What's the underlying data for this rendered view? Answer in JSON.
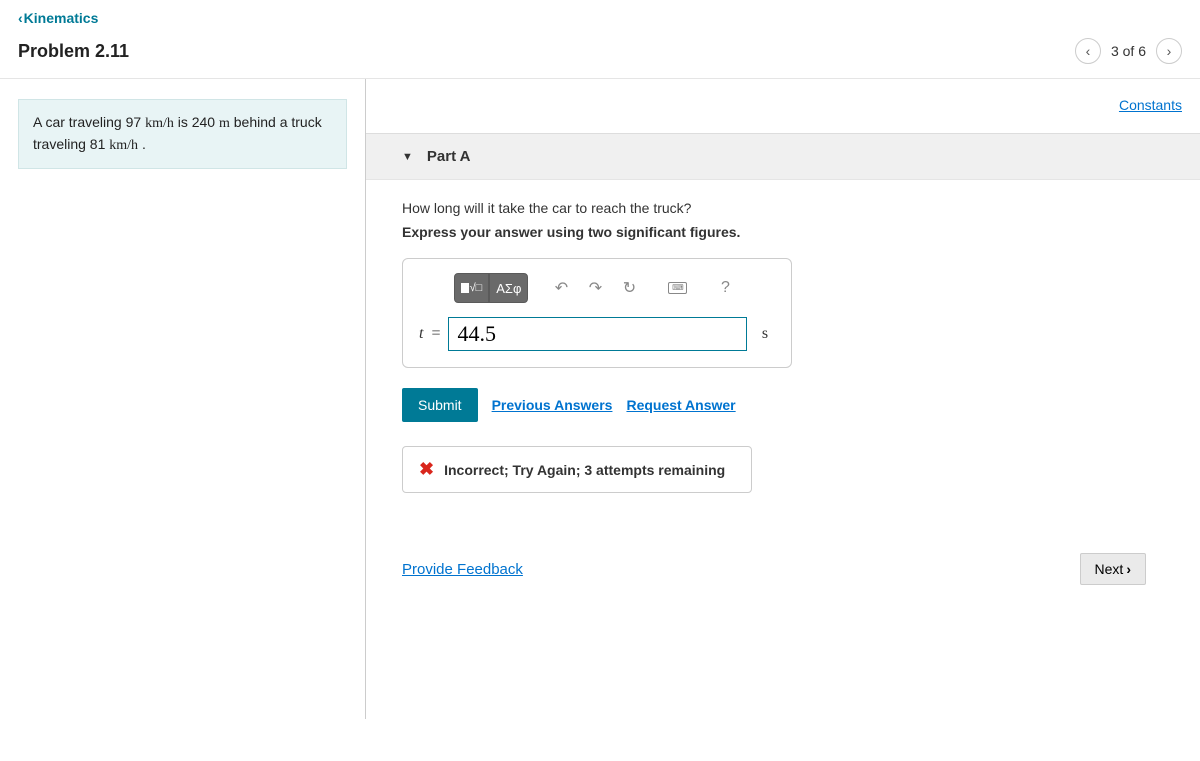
{
  "nav": {
    "back_label": "Kinematics"
  },
  "header": {
    "title": "Problem 2.11",
    "position": "3 of 6"
  },
  "stem": {
    "seg1": "A car traveling 97 ",
    "u1": "km/h",
    "seg2": " is 240 ",
    "u2": "m",
    "seg3": " behind a truck traveling 81 ",
    "u3": "km/h",
    "seg4": " ."
  },
  "constants_label": "Constants",
  "part": {
    "label": "Part A",
    "question": "How long will it take the car to reach the truck?",
    "instruction": "Express your answer using two significant figures.",
    "toolbar": {
      "greek": "ΑΣφ",
      "help": "?"
    },
    "answer": {
      "variable": "t",
      "equals": "=",
      "value": "44.5",
      "unit": "s"
    },
    "submit_label": "Submit",
    "prev_answers_label": "Previous Answers",
    "request_answer_label": "Request Answer",
    "feedback": "Incorrect; Try Again; 3 attempts remaining"
  },
  "footer": {
    "provide_feedback": "Provide Feedback",
    "next": "Next"
  }
}
